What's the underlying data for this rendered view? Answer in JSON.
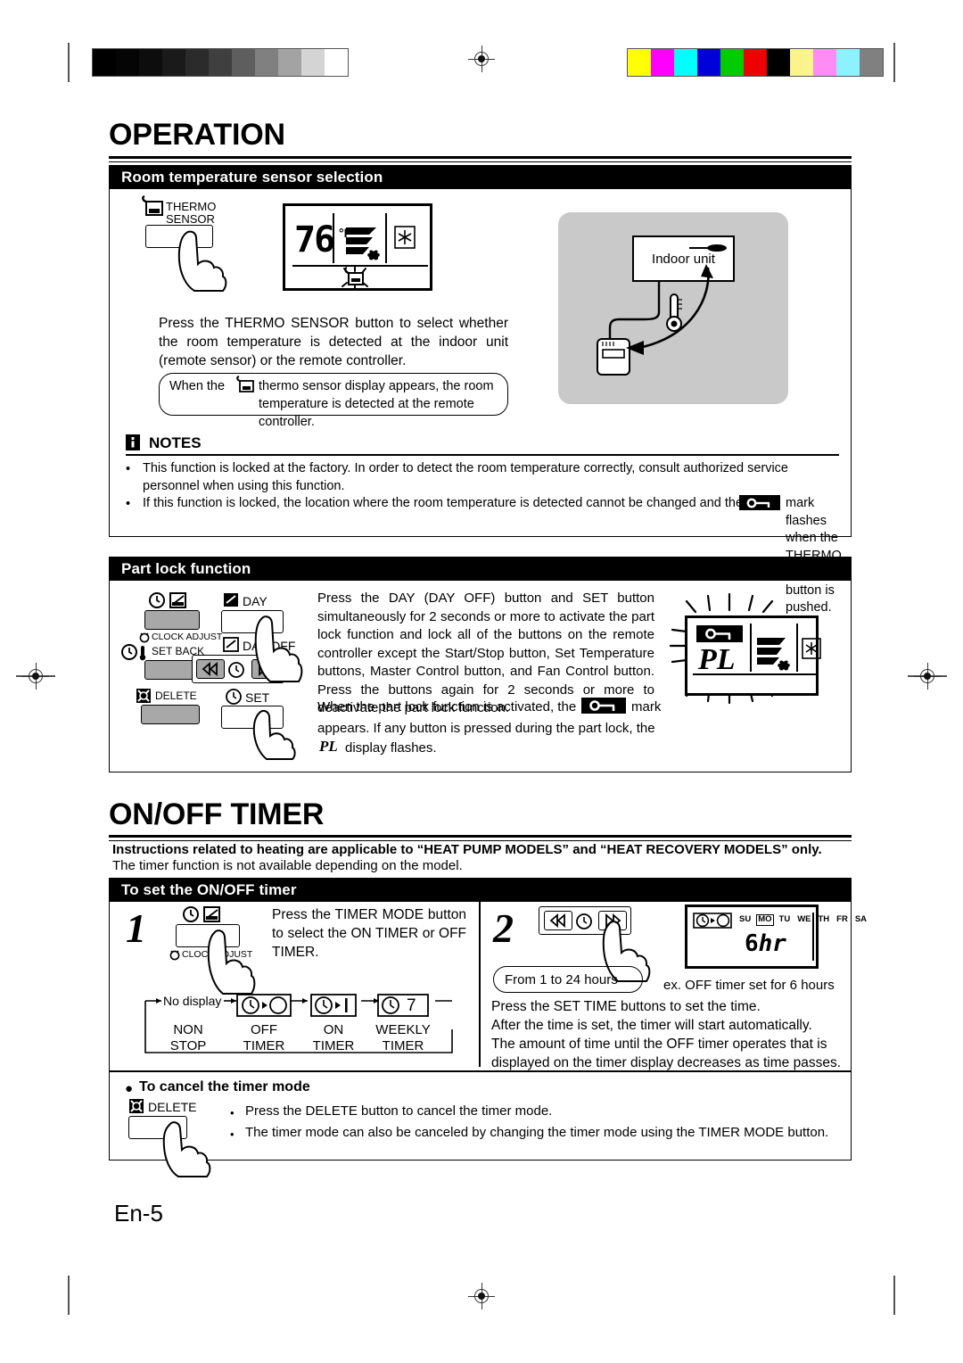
{
  "print_marks": {
    "gray_wedge": [
      "#000000",
      "#050505",
      "#0d0d0d",
      "#1a1a1a",
      "#2b2b2b",
      "#3f3f3f",
      "#5e5e5e",
      "#808080",
      "#a3a3a3",
      "#d4d4d4",
      "#ffffff"
    ],
    "color_wedge": [
      "#ffff00",
      "#ff00ff",
      "#00ffff",
      "#0000d8",
      "#00cc00",
      "#ee0000",
      "#000000",
      "#fbf38c",
      "#ff8cf5",
      "#8cf2ff",
      "#808080"
    ],
    "reg_icon": "registration-target"
  },
  "page": {
    "number": "En-5"
  },
  "operation": {
    "title": "OPERATION",
    "sensor_section": {
      "heading": "Room temperature sensor selection",
      "button_label_line1": "THERMO",
      "button_label_line2": "SENSOR",
      "lcd": {
        "temperature": "76",
        "unit": "°F",
        "fan_icon": "fan-speed-icon",
        "mode_icon": "snowflake-icon",
        "sensor_icon": "thermo-sensor-icon"
      },
      "body": "Press the THERMO SENSOR button to select whether the room temperature is detected at the indoor unit (remote sensor) or the remote controller.",
      "callout_before": "When the",
      "callout_after": "thermo sensor display appears, the room temperature is detected at the remote controller.",
      "diagram": {
        "indoor_unit_label": "Indoor unit",
        "thermometer_icon": "thermometer-icon",
        "remote_icon": "remote-controller-icon"
      }
    },
    "notes": {
      "icon": "info-icon",
      "title": "NOTES",
      "items": [
        "This function is locked at the factory. In order to detect the room temperature correctly, consult authorized service personnel when using this function.",
        "If this function is locked, the location where the room temperature is detected cannot be changed and the"
      ],
      "item2_tail": "mark flashes when the THERMO SENSOR button is pushed.",
      "key_mark_icon": "key-lock-icon"
    },
    "part_lock": {
      "heading": "Part lock function",
      "buttons": {
        "clock_adjust": "CLOCK ADJUST",
        "set_back": "SET BACK",
        "delete": "DELETE",
        "day": "DAY",
        "day_off": "DAY OFF",
        "set": "SET",
        "left_arrow_icon": "arrow-left-icon",
        "right_arrow_icon": "arrow-right-icon",
        "clock_icon": "clock-icon"
      },
      "body1": "Press the DAY (DAY OFF) button and SET button simultaneously for 2 seconds or more to activate the part lock function and lock all of the buttons on the remote controller except the Start/Stop button, Set Temperature buttons, Master Control button, and Fan Control button. Press the buttons again for 2 seconds or more to deactivate the part lock function.",
      "body2_before": "When the part lock function is activated, the",
      "body2_after": "mark",
      "body3": "appears. If any button is pressed during the part lock, the",
      "pl_text": "PL",
      "body3_tail": "display flashes.",
      "lcd": {
        "code": "PL",
        "key_icon": "key-lock-icon",
        "fan_icon": "fan-speed-icon",
        "mode_icon": "snowflake-icon"
      }
    }
  },
  "timer": {
    "title": "ON/OFF TIMER",
    "intro_bold": "Instructions related to heating are applicable to “HEAT PUMP MODELS” and “HEAT RECOVERY MODELS” only.",
    "intro_plain": "The timer function is not available depending on the model.",
    "set_section": {
      "heading": "To set the ON/OFF timer",
      "step1": {
        "number": "1",
        "button_sub_label": "CLOCK ADJUST",
        "text": "Press the TIMER MODE button to select the ON TIMER or OFF TIMER."
      },
      "mode_cycle": {
        "no_display": "No display",
        "items": [
          {
            "icon": "off-timer-icon",
            "label_line1": "NON",
            "label_line2": "STOP"
          },
          {
            "icon": "off-timer-icon",
            "label_line1": "OFF",
            "label_line2": "TIMER"
          },
          {
            "icon": "on-timer-icon",
            "label_line1": "ON",
            "label_line2": "TIMER"
          },
          {
            "icon": "weekly-timer-icon",
            "label_line1": "WEEKLY",
            "label_line2": "TIMER"
          }
        ],
        "weekly_number": "7"
      },
      "step2": {
        "number": "2",
        "range_note": "From 1 to 24 hours",
        "lcd": {
          "mode_icon": "off-timer-icon",
          "days": [
            "SU",
            "MO",
            "TU",
            "WE",
            "TH",
            "FR",
            "SA"
          ],
          "active_day": "MO",
          "value": "6",
          "value_unit": "hr"
        },
        "example_caption": "ex. OFF timer set for 6 hours",
        "text": "Press the SET TIME buttons to set the time.\nAfter the time is set, the timer will start automatically.\nThe amount of time until the OFF timer operates that is displayed on the timer display decreases as time passes."
      },
      "cancel": {
        "heading": "To cancel the timer mode",
        "button_label": "DELETE",
        "items": [
          "Press the DELETE button to cancel the timer mode.",
          "The timer mode can also be canceled by changing the timer mode using the TIMER MODE button."
        ]
      }
    }
  }
}
